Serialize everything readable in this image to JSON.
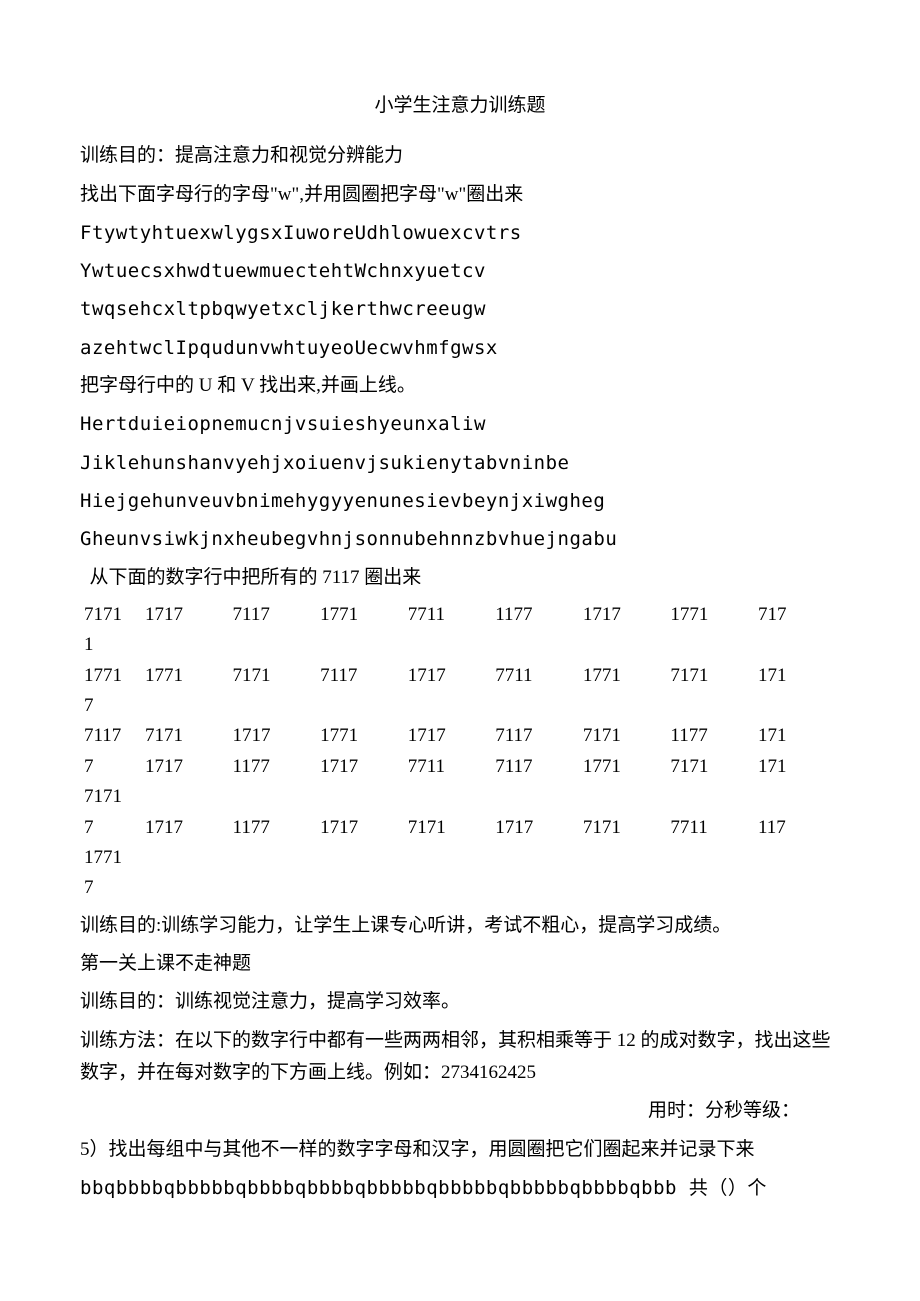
{
  "title": "小学生注意力训练题",
  "lines": {
    "goal1": "训练目的：提高注意力和视觉分辨能力",
    "task1": "找出下面字母行的字母\"w\",并用圆圈把字母\"w\"圈出来",
    "w1": "FtywtyhtuexwlygsxIuworeUdhlowuexcvtrs",
    "w2": "YwtuecsxhwdtuewmuectehtWchnxyuetcv",
    "w3": "twqsehcxltpbqwyetxcljkerthwcreeugw",
    "w4": "azehtwclIpqudunvwhtuyeoUecwvhmfgwsx",
    "task2": "把字母行中的 U 和 V 找出来,并画上线。",
    "uv1": "Hertduieiopnemucnjvsuieshyeunxaliw",
    "uv2": "Jiklehunshanvyehjxoiuenvjsukienytabvninbe",
    "uv3": "Hiejgehunveuvbnimehygyyenunesievbeynjxiwgheg",
    "uv4": "Gheunvsiwkjnxheubegvhnjsonnubehnnzbvhuejngabu",
    "task3": "  从下面的数字行中把所有的 7117 圈出来",
    "goal2": "训练目的:训练学习能力，让学生上课专心听讲，考试不粗心，提高学习成绩。",
    "level1": "第一关上课不走神题",
    "goal3": "训练目的：训练视觉注意力，提高学习效率。",
    "method": "训练方法：在以下的数字行中都有一些两两相邻，其积相乘等于 12 的成对数字，找出这些数字，并在每对数字的下方画上线。例如：2734162425",
    "timer": "用时：分秒等级：",
    "task5": "5）找出每组中与其他不一样的数字字母和汉字，用圆圈把它们圈起来并记录下来",
    "bbq": "bbqbbbbqbbbbbqbbbbqbbbbqbbbbbqbbbbbqbbbbbqbbbbqbbb 共（）个"
  },
  "numtable": [
    [
      [
        "7171",
        "1"
      ],
      "1717",
      "7117",
      "1771",
      "7711",
      "1177",
      "1717",
      "1771",
      "717"
    ],
    [
      [
        "1771",
        "7"
      ],
      "1771",
      "7171",
      "7117",
      "1717",
      "7711",
      "1771",
      "7171",
      "171"
    ],
    [
      [
        "7117",
        ""
      ],
      "7171",
      "1717",
      "1771",
      "1717",
      "7117",
      "7171",
      "1177",
      "171"
    ],
    [
      [
        "7",
        "7171"
      ],
      "1717",
      "1177",
      "1717",
      "7711",
      "7117",
      "1771",
      "7171",
      "171"
    ],
    [
      [
        "7",
        "1771",
        "7"
      ],
      "1717",
      "1177",
      "1717",
      "7171",
      "1717",
      "7171",
      "7711",
      "117"
    ]
  ]
}
